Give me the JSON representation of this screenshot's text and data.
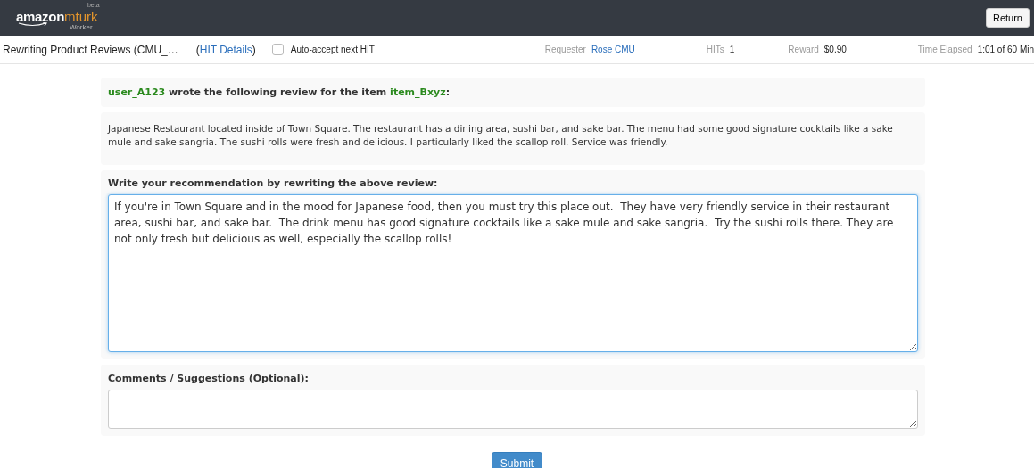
{
  "logo": {
    "brand": "amazon",
    "product": "mturk",
    "badge": "beta",
    "subtitle": "Worker"
  },
  "header": {
    "return_button": "Return"
  },
  "hit_bar": {
    "title": "Rewriting Product Reviews (CMU_…",
    "details_link": "HIT Details",
    "details_open": "(",
    "details_close": ")",
    "auto_accept": {
      "label": "Auto-accept next HIT",
      "checked": false
    },
    "stats": [
      {
        "label": "Requester",
        "value": "Rose CMU",
        "kind": "link"
      },
      {
        "label": "HITs",
        "value": "1",
        "kind": "text"
      },
      {
        "label": "Reward",
        "value": "$0.90",
        "kind": "text"
      },
      {
        "label": "Time Elapsed",
        "value": "1:01 of 60 Min",
        "kind": "text"
      }
    ]
  },
  "review": {
    "heading": "**user_A123** wrote the following review for the item **item_Bxyz**:",
    "text": "Japanese Restaurant located inside of Town Square. The restaurant has a dining area, sushi bar, and sake bar. The menu had some good signature cocktails like a sake mule and sake sangria. The sushi rolls were fresh and delicious. I particularly liked the scallop roll. Service was friendly."
  },
  "rewrite": {
    "label": "Write your recommendation by rewriting the above review:",
    "value": "If you're in Town Square and in the mood for Japanese food, then you must try this place out.  They have very friendly service in their restaurant area, sushi bar, and sake bar.  The drink menu has good signature cocktails like a sake mule and sake sangria.  Try the sushi rolls there. They are not only fresh but delicious as well, especially the scallop rolls!",
    "focused": true
  },
  "comments": {
    "label": "Comments / Suggestions (Optional):"
  },
  "submit_button": "Submit"
}
